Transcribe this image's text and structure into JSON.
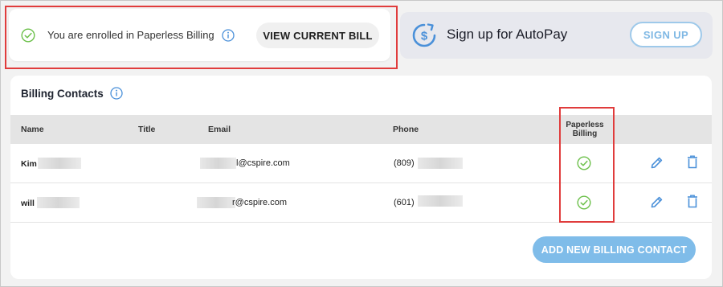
{
  "paperless_banner": {
    "message": "You are enrolled in Paperless Billing",
    "view_bill_label": "VIEW CURRENT BILL"
  },
  "autopay_banner": {
    "title": "Sign up for AutoPay",
    "signup_label": "SIGN UP"
  },
  "contacts": {
    "title": "Billing Contacts",
    "columns": {
      "name": "Name",
      "title": "Title",
      "email": "Email",
      "phone": "Phone",
      "paperless": "Paperless Billing"
    },
    "rows": [
      {
        "name": "Kim",
        "title": "",
        "email": "l@cspire.com",
        "phone": "(809)",
        "paperless": true
      },
      {
        "name": "will",
        "title": "",
        "email": "r@cspire.com",
        "phone": "(601)",
        "paperless": true
      }
    ],
    "add_label": "ADD NEW BILLING CONTACT"
  },
  "icons": {
    "check": "check-circle-icon",
    "info": "info-icon",
    "dollar": "dollar-cycle-icon",
    "edit": "pencil-icon",
    "delete": "trash-icon"
  },
  "colors": {
    "check_green": "#6cc04a",
    "accent_blue": "#4a90d9",
    "button_blue": "#7fbce9",
    "highlight_red": "#e03c3c"
  }
}
